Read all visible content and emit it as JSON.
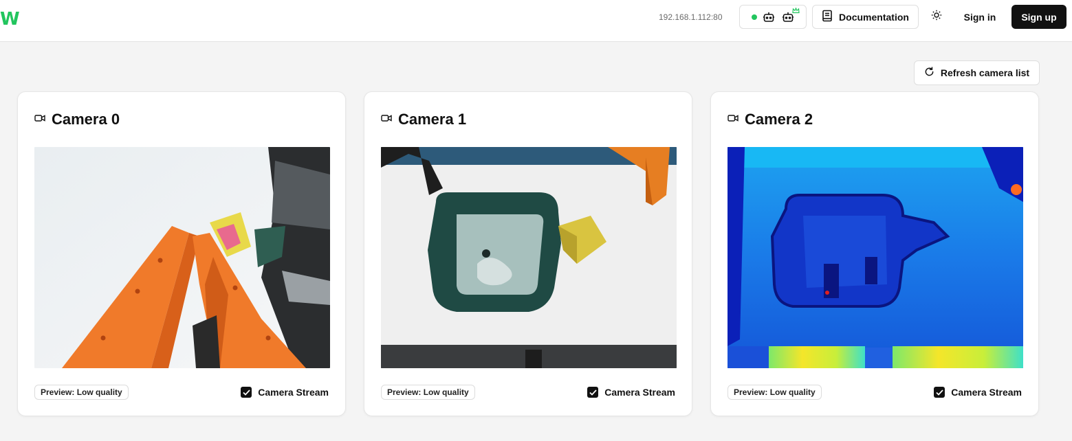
{
  "header": {
    "logo_text": "W",
    "ip_address": "192.168.1.112:80",
    "documentation_label": "Documentation",
    "sign_in_label": "Sign in",
    "sign_up_label": "Sign up",
    "status_color": "#22c55e"
  },
  "toolbar": {
    "refresh_label": "Refresh camera list"
  },
  "cameras": [
    {
      "title": "Camera 0",
      "preview_label": "Preview: Low quality",
      "stream_label": "Camera Stream",
      "stream_checked": true
    },
    {
      "title": "Camera 1",
      "preview_label": "Preview: Low quality",
      "stream_label": "Camera Stream",
      "stream_checked": true
    },
    {
      "title": "Camera 2",
      "preview_label": "Preview: Low quality",
      "stream_label": "Camera Stream",
      "stream_checked": true
    }
  ],
  "icons": {
    "robot": "robot-icon",
    "crown": "crown-icon",
    "documentation": "book-icon",
    "theme": "sun-icon",
    "refresh": "refresh-icon",
    "camera": "video-camera-icon",
    "check": "check-icon"
  }
}
